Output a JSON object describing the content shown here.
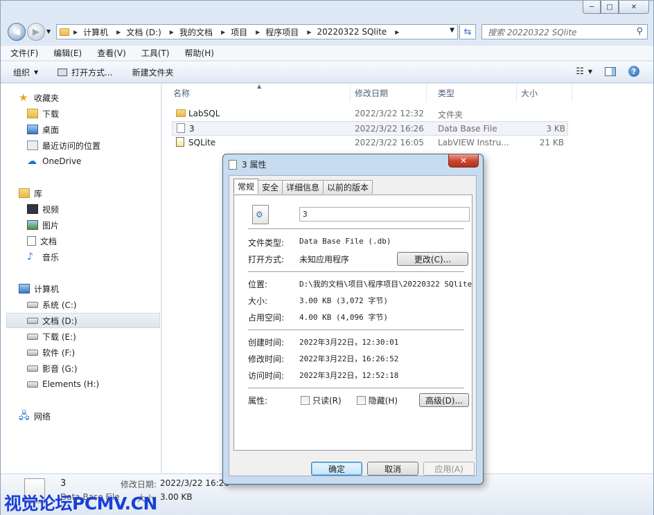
{
  "window": {
    "caption_buttons": {
      "minimize": "─",
      "maximize": "□",
      "close": "✕"
    }
  },
  "nav": {
    "breadcrumbs": [
      "计算机",
      "文档 (D:)",
      "我的文档",
      "项目",
      "程序项目",
      "20220322 SQlite"
    ],
    "search_placeholder": "搜索 20220322 SQlite"
  },
  "menu": [
    "文件(F)",
    "编辑(E)",
    "查看(V)",
    "工具(T)",
    "帮助(H)"
  ],
  "toolbar": {
    "organize": "组织",
    "open_with": "打开方式...",
    "new_folder": "新建文件夹"
  },
  "sidebar": {
    "favorites": {
      "label": "收藏夹",
      "items": [
        "下载",
        "桌面",
        "最近访问的位置",
        "OneDrive"
      ]
    },
    "libraries": {
      "label": "库",
      "items": [
        "视频",
        "图片",
        "文档",
        "音乐"
      ]
    },
    "computer": {
      "label": "计算机",
      "items": [
        "系统 (C:)",
        "文档 (D:)",
        "下载 (E:)",
        "软件 (F:)",
        "影音 (G:)",
        "Elements (H:)"
      ]
    },
    "network": {
      "label": "网络"
    }
  },
  "columns": {
    "name": "名称",
    "modified": "修改日期",
    "type": "类型",
    "size": "大小"
  },
  "files": [
    {
      "name": "LabSQL",
      "modified": "2022/3/22 12:32",
      "type": "文件夹",
      "size": ""
    },
    {
      "name": "3",
      "modified": "2022/3/22 16:26",
      "type": "Data Base File",
      "size": "3 KB"
    },
    {
      "name": "SQLite",
      "modified": "2022/3/22 16:05",
      "type": "LabVIEW Instru...",
      "size": "21 KB"
    }
  ],
  "details_pane": {
    "name": "3",
    "modified_label": "修改日期:",
    "modified_value": "2022/3/22 16:26",
    "type": "Data Base File",
    "size_label": "大小:",
    "size_value": "3.00 KB"
  },
  "watermark": "视觉论坛PCMV.CN",
  "dialog": {
    "title": "3 属性",
    "close": "✕",
    "tabs": [
      "常规",
      "安全",
      "详细信息",
      "以前的版本"
    ],
    "file_name": "3",
    "file_type_label": "文件类型:",
    "file_type_value": "Data Base File (.db)",
    "open_with_label": "打开方式:",
    "open_with_value": "未知应用程序",
    "change_button": "更改(C)...",
    "location_label": "位置:",
    "location_value": "D:\\我的文档\\项目\\程序项目\\20220322 SQlite",
    "size_label": "大小:",
    "size_value": "3.00 KB (3,072 字节)",
    "size_on_disk_label": "占用空间:",
    "size_on_disk_value": "4.00 KB (4,096 字节)",
    "created_label": "创建时间:",
    "created_value": "2022年3月22日，12:30:01",
    "modified_label": "修改时间:",
    "modified_value": "2022年3月22日，16:26:52",
    "accessed_label": "访问时间:",
    "accessed_value": "2022年3月22日，12:52:18",
    "attributes_label": "属性:",
    "readonly_label": "只读(R)",
    "hidden_label": "隐藏(H)",
    "advanced_button": "高级(D)...",
    "ok_button": "确定",
    "cancel_button": "取消",
    "apply_button": "应用(A)"
  }
}
